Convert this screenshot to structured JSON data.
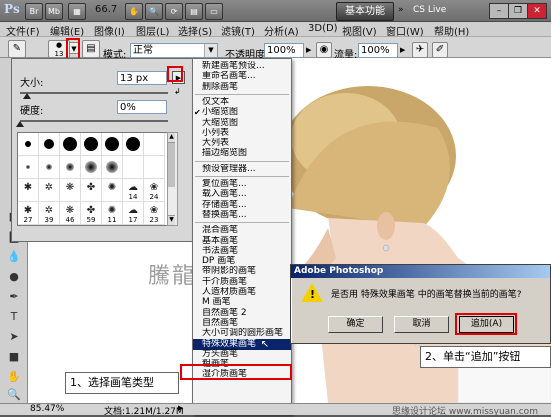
{
  "app": {
    "logo": "Ps",
    "menu": [
      "文件(F)",
      "编辑(E)",
      "图像(I)",
      "图层(L)",
      "选择(S)",
      "滤镜(T)",
      "分析(A)",
      "3D(D)",
      "视图(V)",
      "窗口(W)",
      "帮助(H)"
    ],
    "quick_icons": [
      "Br",
      "Mb"
    ],
    "zoom": "66.7",
    "workspace": "基本功能",
    "cs_live": "CS Live"
  },
  "options": {
    "brush_size_small": "13",
    "mode_label": "模式:",
    "mode_value": "正常",
    "opacity_label": "不透明度:",
    "opacity_value": "100%",
    "flow_label": "流量:",
    "flow_value": "100%"
  },
  "brush_panel": {
    "size_label": "大小:",
    "size_value": "13 px",
    "hardness_label": "硬度:",
    "hardness_value": "0%",
    "size_slider": 0.05,
    "hardness_slider": 0.0,
    "brushes": [
      {
        "n": ""
      },
      {
        "n": ""
      },
      {
        "n": ""
      },
      {
        "n": ""
      },
      {
        "n": ""
      },
      {
        "n": ""
      },
      {
        "n": ""
      },
      {
        "n": ""
      },
      {
        "n": ""
      },
      {
        "n": ""
      },
      {
        "n": ""
      },
      {
        "n": ""
      },
      {
        "n": ""
      },
      {
        "n": ""
      },
      {
        "n": ""
      },
      {
        "n": ""
      },
      {
        "n": ""
      },
      {
        "n": ""
      },
      {
        "n": ""
      },
      {
        "n": "14"
      },
      {
        "n": "24"
      },
      {
        "n": "27"
      },
      {
        "n": "39"
      },
      {
        "n": "46"
      },
      {
        "n": "59"
      },
      {
        "n": "11"
      },
      {
        "n": "17"
      },
      {
        "n": "23"
      }
    ]
  },
  "menu": {
    "items": [
      {
        "label": "新建画笔预设..."
      },
      {
        "label": "重命名画笔..."
      },
      {
        "label": "删除画笔"
      },
      {
        "sep": true
      },
      {
        "label": "仅文本"
      },
      {
        "label": "小缩览图",
        "checked": true
      },
      {
        "label": "大缩览图"
      },
      {
        "label": "小列表"
      },
      {
        "label": "大列表"
      },
      {
        "label": "描边缩览图"
      },
      {
        "sep": true
      },
      {
        "label": "预设管理器..."
      },
      {
        "sep": true
      },
      {
        "label": "复位画笔..."
      },
      {
        "label": "载入画笔..."
      },
      {
        "label": "存储画笔..."
      },
      {
        "label": "替换画笔..."
      },
      {
        "sep": true
      },
      {
        "label": "混合画笔"
      },
      {
        "label": "基本画笔"
      },
      {
        "label": "书法画笔"
      },
      {
        "label": "DP 画笔"
      },
      {
        "label": "带阴影的画笔"
      },
      {
        "label": "干介质画笔"
      },
      {
        "label": "人造材质画笔"
      },
      {
        "label": "M 画笔"
      },
      {
        "label": "自然画笔 2"
      },
      {
        "label": "自然画笔"
      },
      {
        "label": "大小可调的圆形画笔"
      },
      {
        "label": "特殊效果画笔",
        "selected": true
      },
      {
        "label": "方头画笔"
      },
      {
        "label": "粗画笔"
      },
      {
        "label": "湿介质画笔"
      }
    ]
  },
  "dialog": {
    "title": "Adobe Photoshop",
    "message": "是否用 特殊效果画笔 中的画笔替换当前的画笔?",
    "buttons": [
      "确定",
      "取消",
      "追加(A)"
    ]
  },
  "callouts": {
    "step1": "1、选择画笔类型",
    "step2": "2、单击“追加”按钮"
  },
  "watermark": "騰龍視覺 WWW",
  "status": {
    "zoom": "85.47%",
    "doc": "文档:1.21M/1.27M"
  },
  "footer_credit": "思缘设计论坛 www.missyuan.com",
  "colors": {
    "highlight": "#0a246a",
    "annotation_red": "#e00000",
    "dialog_gray": "#d4d0c8"
  }
}
